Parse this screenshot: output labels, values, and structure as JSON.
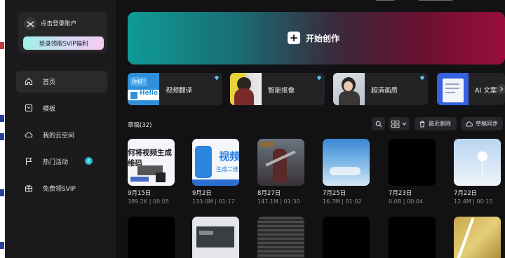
{
  "sidebar": {
    "login_text": "点击登录账户",
    "svip_button": "登录领取SVIP福利",
    "nav": [
      {
        "label": "首页",
        "icon": "home-icon"
      },
      {
        "label": "模板",
        "icon": "template-icon"
      },
      {
        "label": "我的云空间",
        "icon": "cloud-icon"
      },
      {
        "label": "热门活动",
        "icon": "flag-icon",
        "badge": "6"
      },
      {
        "label": "免费领SVIP",
        "icon": "gift-icon"
      }
    ]
  },
  "hero": {
    "label": "开始创作"
  },
  "tools": [
    {
      "label": "视频翻译",
      "thumb_text_1": "你好!",
      "thumb_text_2": "Hello"
    },
    {
      "label": "智能抠像"
    },
    {
      "label": "超清画质"
    },
    {
      "label": "AI 文案"
    }
  ],
  "drafts": {
    "title": "草稿(32)",
    "recent_delete": "最近删除",
    "draft_sync": "草稿同步",
    "items": [
      {
        "date": "9月15日",
        "meta": "389.2K | 00:05",
        "thumb_text_1": "何将视频生成",
        "thumb_text_2": "维码"
      },
      {
        "date": "9月2日",
        "meta": "133.0M | 01:17",
        "thumb_text_1": "视频",
        "thumb_text_2": "生成二维"
      },
      {
        "date": "8月27日",
        "meta": "147.1M | 01:30"
      },
      {
        "date": "7月25日",
        "meta": "16.7M | 01:02"
      },
      {
        "date": "7月23日",
        "meta": "0.0B | 00:04"
      },
      {
        "date": "7月22日",
        "meta": "12.4M | 00:15"
      }
    ]
  },
  "colors": {
    "accent_badge": "#21b8c5",
    "diamond": "#5cc6ff"
  }
}
